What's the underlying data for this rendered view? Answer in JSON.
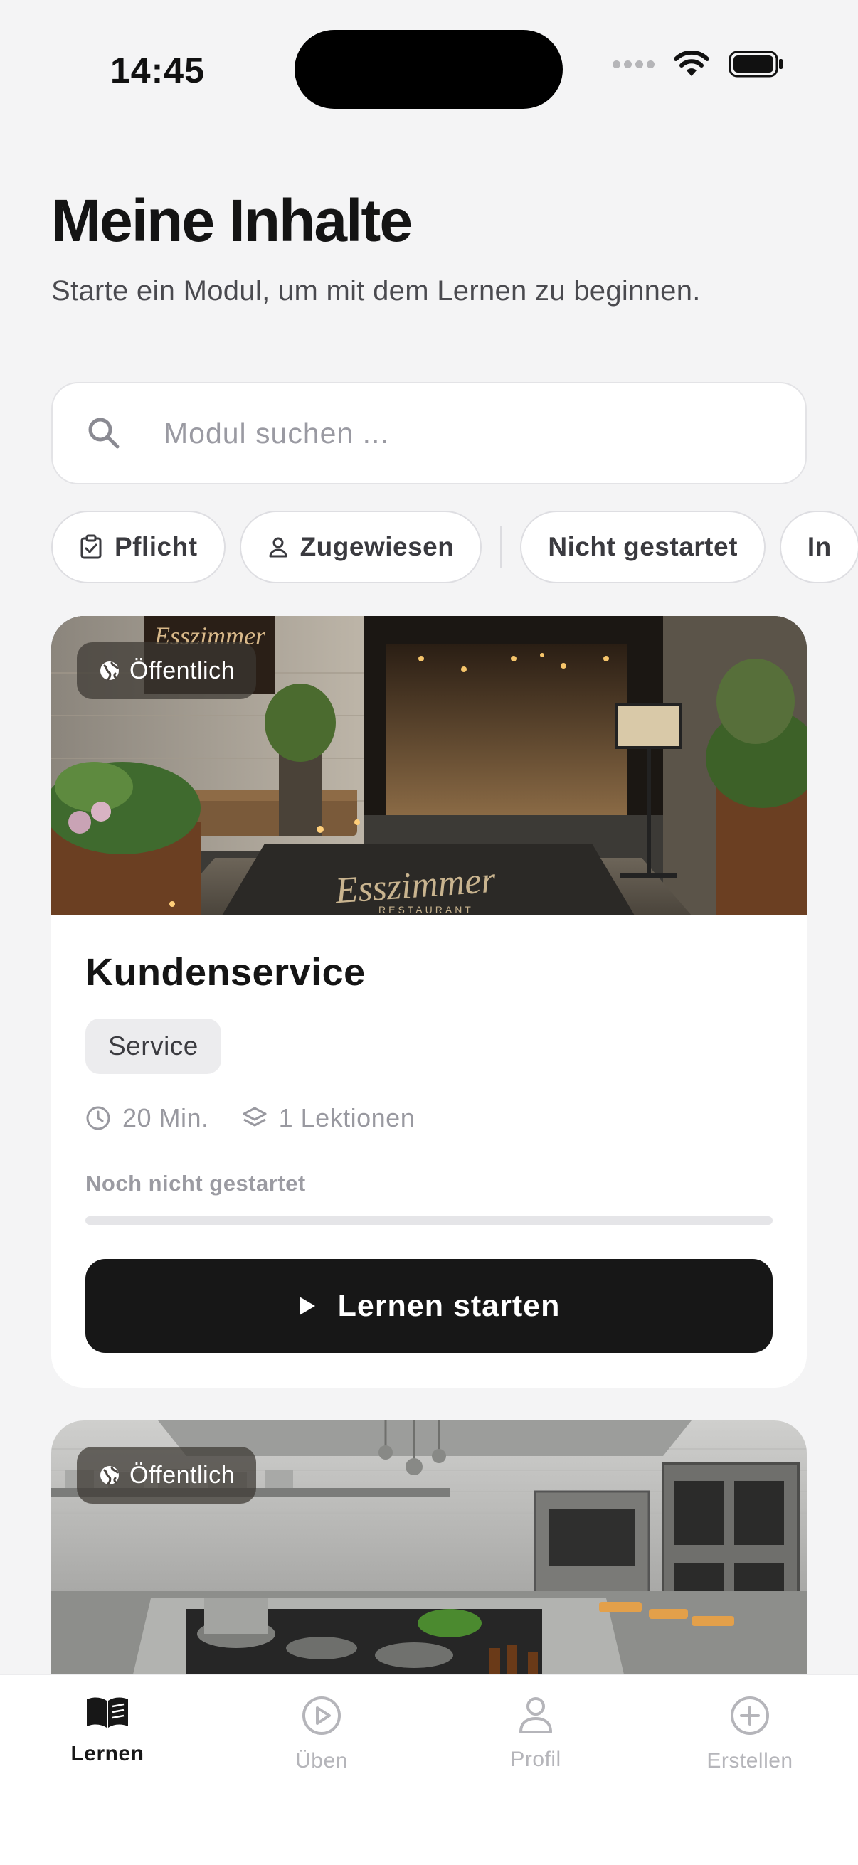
{
  "status_bar": {
    "time": "14:45"
  },
  "header": {
    "title": "Meine Inhalte",
    "subtitle": "Starte ein Modul, um mit dem Lernen zu beginnen."
  },
  "search": {
    "placeholder": "Modul suchen ...",
    "value": ""
  },
  "filters": {
    "pflicht": "Pflicht",
    "zugewiesen": "Zugewiesen",
    "nicht_gestartet": "Nicht gestartet",
    "in_bearbeitung": "In"
  },
  "modules": [
    {
      "badge": "Öffentlich",
      "title": "Kundenservice",
      "tag": "Service",
      "duration": "20 Min.",
      "lessons": "1 Lektionen",
      "status": "Noch nicht gestartet",
      "progress": 0,
      "button": "Lernen starten",
      "image_text_sign": "Esszimmer",
      "image_text_mat": "Esszimmer",
      "image_text_mat_sub": "RESTAURANT"
    },
    {
      "badge": "Öffentlich"
    }
  ],
  "tabbar": {
    "lernen": "Lernen",
    "ueben": "Üben",
    "profil": "Profil",
    "erstellen": "Erstellen"
  },
  "colors": {
    "accent": "#171717",
    "background": "#f4f4f5",
    "muted": "#9b9ba2"
  }
}
